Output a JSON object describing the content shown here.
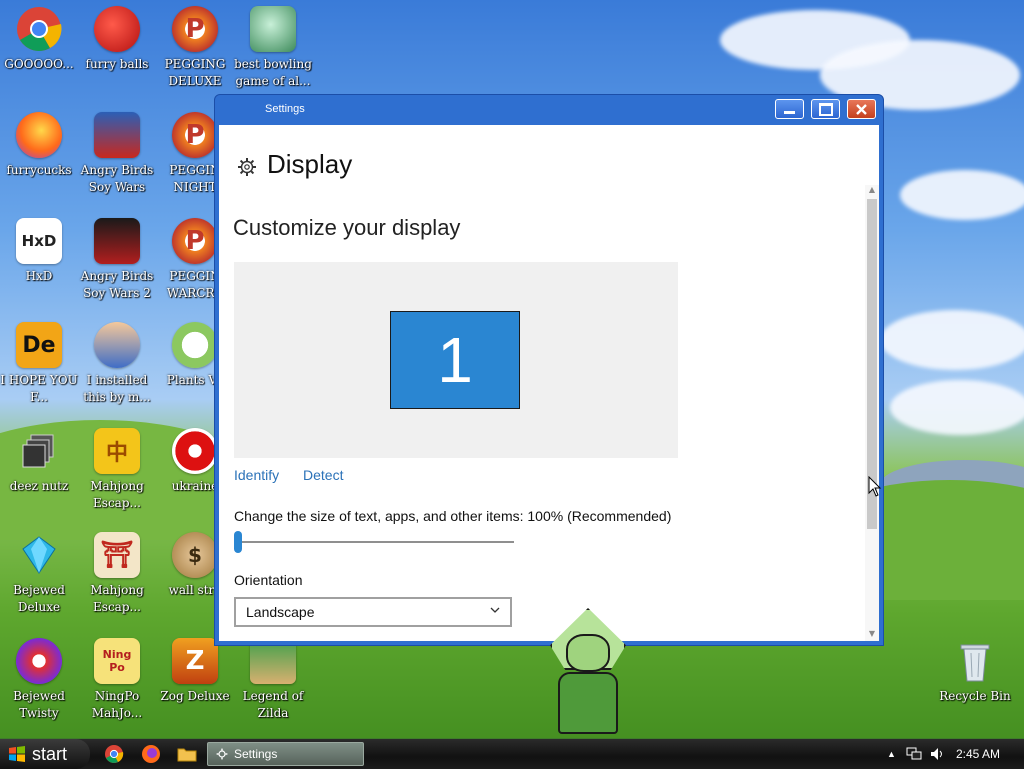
{
  "desktop": {
    "icons": [
      {
        "label": "GOOOOO...",
        "icon": "chrome-icon"
      },
      {
        "label": "furry balls",
        "icon": "red-fuzzy-ball-icon"
      },
      {
        "label": "PEGGING DELUXE",
        "icon": "pegging-p-icon"
      },
      {
        "label": "best bowling game of al...",
        "icon": "bowling-santa-icon"
      },
      {
        "label": "furrycucks",
        "icon": "firefox-icon"
      },
      {
        "label": "Angry Birds Soy Wars",
        "icon": "angry-birds-star-wars-icon"
      },
      {
        "label": "PEGGIN NIGHT",
        "icon": "pegging-p-icon"
      },
      {
        "label": "HxD",
        "icon": "hxd-icon"
      },
      {
        "label": "Angry Birds Soy Wars 2",
        "icon": "angry-birds-star-wars-2-icon"
      },
      {
        "label": "PEGGIN WARCRA",
        "icon": "pegging-p-icon"
      },
      {
        "label": "I HOPE YOU F...",
        "icon": "de-icon"
      },
      {
        "label": "I installed this by m...",
        "icon": "cartoon-character-icon"
      },
      {
        "label": "Plants Vs",
        "icon": "plants-vs-zombies-icon"
      },
      {
        "label": "deez nutz",
        "icon": "stacked-windows-icon"
      },
      {
        "label": "Mahjong Escap...",
        "icon": "mahjong-tile-icon"
      },
      {
        "label": "ukraine",
        "icon": "radiation-icon"
      },
      {
        "label": "Bejewed Deluxe",
        "icon": "gem-icon"
      },
      {
        "label": "Mahjong Escap...",
        "icon": "torii-gate-icon"
      },
      {
        "label": "wall stre",
        "icon": "money-bag-icon"
      },
      {
        "label": "Bejewed Twisty",
        "icon": "twist-gem-icon"
      },
      {
        "label": "NingPo MahJo...",
        "icon": "ningpo-tile-icon"
      },
      {
        "label": "Zog Deluxe",
        "icon": "zog-z-icon"
      },
      {
        "label": "Legend of Zilda",
        "icon": "zelda-character-icon"
      },
      {
        "label": "Recycle Bin",
        "icon": "recycle-bin-icon"
      }
    ],
    "pegging_glyph": "P",
    "hxd_glyph": "HxD",
    "de_glyph": "De",
    "mahjong_glyph": "中",
    "torii_glyph": "⛩",
    "money_glyph": "$",
    "ningpo_glyph": "Ning Po",
    "zog_glyph": "Z"
  },
  "window": {
    "title": "Settings",
    "minimize_icon": "minimize-icon",
    "maximize_icon": "maximize-icon",
    "close_icon": "close-icon",
    "page_title": "Display",
    "section_title": "Customize your display",
    "monitor_number": "1",
    "identify_label": "Identify",
    "detect_label": "Detect",
    "scale_label": "Change the size of text, apps, and other items: 100% (Recommended)",
    "scale_value_fraction": 0.0,
    "orientation_label": "Orientation",
    "orientation_value": "Landscape",
    "accent": "#2a86d2"
  },
  "taskbar": {
    "start_label": "start",
    "task_label": "Settings",
    "clock": "2:45 AM"
  }
}
